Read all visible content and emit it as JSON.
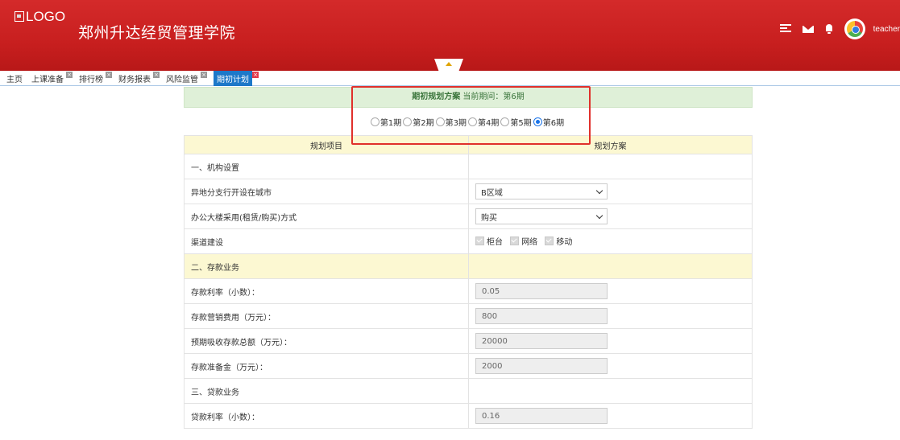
{
  "header": {
    "logo_text": "LOGO",
    "title": "郑州升达经贸管理学院",
    "user": "teacher",
    "colors": {
      "bar": "#c81f1f"
    }
  },
  "tabs": [
    {
      "label": "主页",
      "closable": false,
      "active": false
    },
    {
      "label": "上课准备",
      "closable": true,
      "active": false
    },
    {
      "label": "排行榜",
      "closable": true,
      "active": false
    },
    {
      "label": "财务报表",
      "closable": true,
      "active": false
    },
    {
      "label": "风险监管",
      "closable": true,
      "active": false
    },
    {
      "label": "期初计划",
      "closable": true,
      "active": true
    }
  ],
  "plan": {
    "heading": "期初规划方案",
    "current_period": "当前期间：第6期",
    "periods": [
      "第1期",
      "第2期",
      "第3期",
      "第4期",
      "第5期",
      "第6期"
    ],
    "selected_period": "第6期"
  },
  "table": {
    "col_item": "规划项目",
    "col_plan": "规划方案",
    "sec1": "一、机构设置",
    "city_label": "异地分支行开设在城市",
    "city_value": "B区域",
    "office_label": "办公大楼采用(租赁/购买)方式",
    "office_value": "购买",
    "channel_label": "渠道建设",
    "channels": [
      "柜台",
      "网络",
      "移动"
    ],
    "sec2": "二、存款业务",
    "dep_rate_label": "存款利率（小数）：",
    "dep_rate_value": "0.05",
    "dep_mkt_label": "存款营销费用（万元）：",
    "dep_mkt_value": "800",
    "dep_total_label": "预期吸收存款总额（万元）：",
    "dep_total_value": "20000",
    "dep_reserve_label": "存款准备金（万元）：",
    "dep_reserve_value": "2000",
    "sec3": "三、贷款业务",
    "loan_rate_label": "贷款利率（小数）：",
    "loan_rate_value": "0.16"
  }
}
